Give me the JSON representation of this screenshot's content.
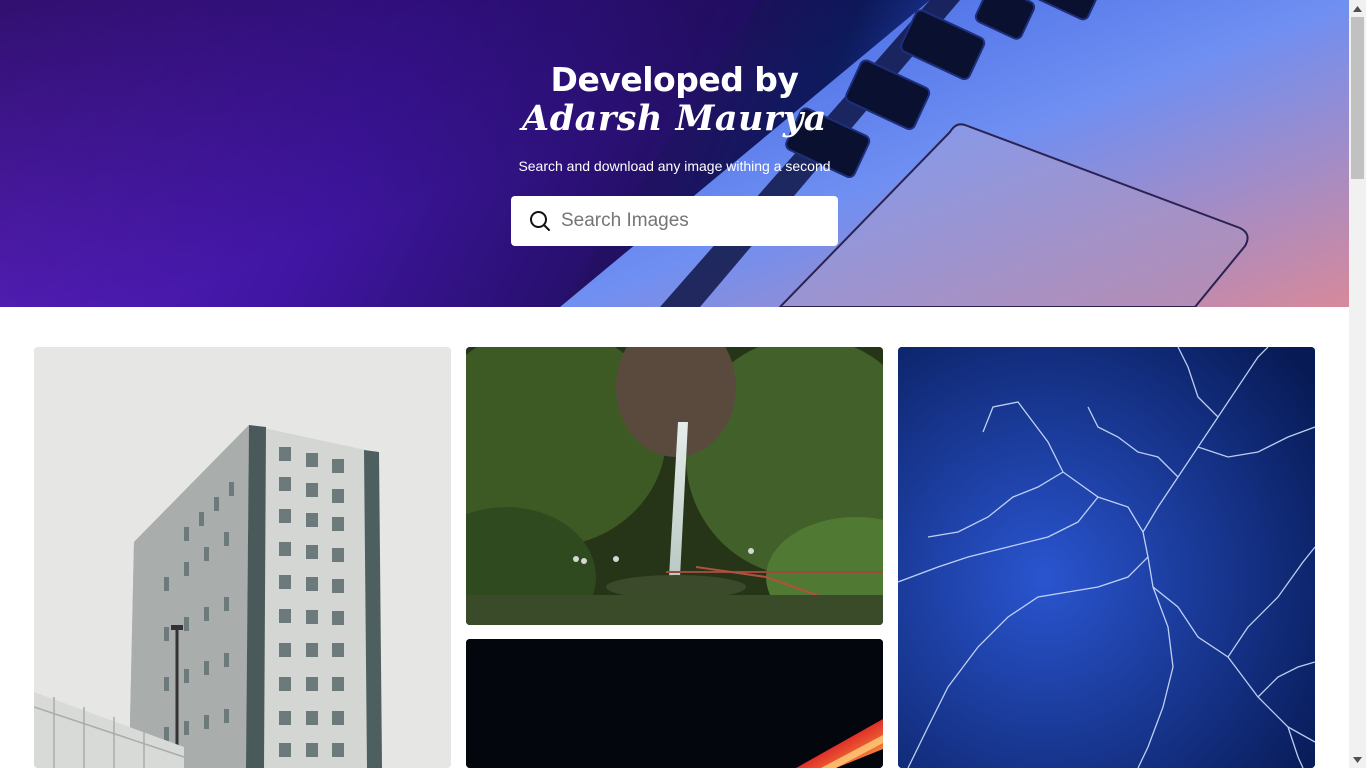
{
  "hero": {
    "title": "Developed by",
    "name": "Adarsh Maurya",
    "subtitle": "Search and download any image withing a second",
    "background_image": "laptop-keyboard-purple-blue"
  },
  "search": {
    "placeholder": "Search Images",
    "value": "",
    "icon": "search-icon"
  },
  "gallery": {
    "images": [
      {
        "subject": "tall-building-against-grey-sky"
      },
      {
        "subject": "waterfall-in-green-forest"
      },
      {
        "subject": "dark-light-streak"
      },
      {
        "subject": "blue-lightning-sky"
      }
    ]
  },
  "colors": {
    "hero_purple": "#7c2ef0",
    "hero_blue": "#2b56d8",
    "search_bg": "#ffffff",
    "page_bg": "#ffffff",
    "scrollbar_thumb": "#c1c1c1"
  }
}
